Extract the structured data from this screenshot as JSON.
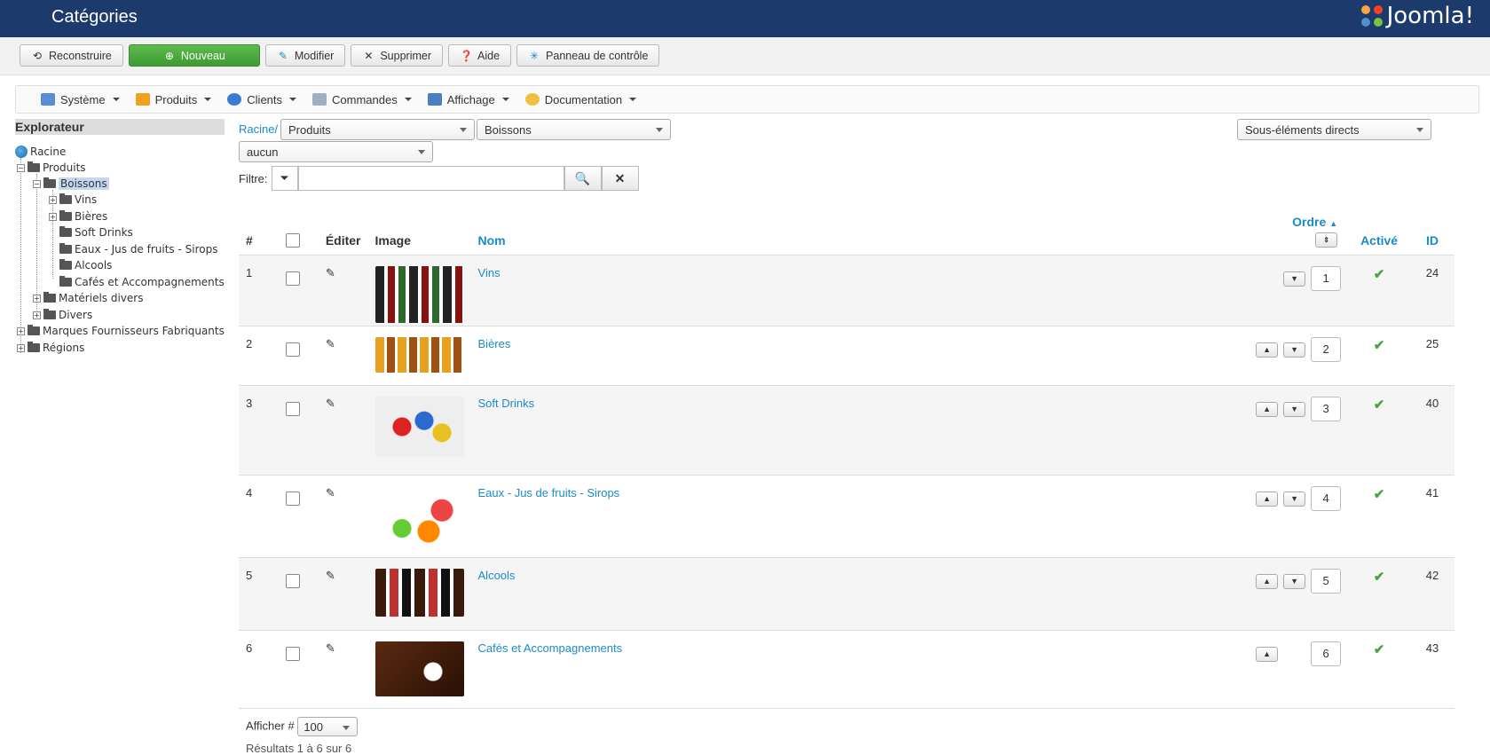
{
  "header": {
    "title": "Catégories",
    "logo_text": "Joomla!"
  },
  "toolbar": [
    {
      "label": "Reconstruire",
      "icon": "rebuild-icon"
    },
    {
      "label": "Nouveau",
      "icon": "plus-circle-icon"
    },
    {
      "label": "Modifier",
      "icon": "edit-icon"
    },
    {
      "label": "Supprimer",
      "icon": "close-icon"
    },
    {
      "label": "Aide",
      "icon": "question-icon"
    },
    {
      "label": "Panneau de contrôle",
      "icon": "dashboard-icon"
    }
  ],
  "menu": [
    "Système",
    "Produits",
    "Clients",
    "Commandes",
    "Affichage",
    "Documentation"
  ],
  "explorer": {
    "title": "Explorateur",
    "nodes": [
      "Racine",
      "Produits",
      "Boissons",
      "Vins",
      "Bières",
      "Soft Drinks",
      "Eaux - Jus de fruits - Sirops",
      "Alcools",
      "Cafés et Accompagnements",
      "Matériels divers",
      "Divers",
      "Marques Fournisseurs Fabriquants",
      "Régions"
    ]
  },
  "breadcrumb": {
    "root": "Racine/",
    "level1": "Produits",
    "level2": "Boissons",
    "level3": "aucun",
    "scope": "Sous-éléments directs"
  },
  "filter": {
    "label": "Filtre:",
    "value": ""
  },
  "columns": {
    "num": "#",
    "edit": "Éditer",
    "image": "Image",
    "name": "Nom",
    "order": "Ordre",
    "active": "Activé",
    "id": "ID"
  },
  "rows": [
    {
      "num": "1",
      "name": "Vins",
      "order": "1",
      "id": "24"
    },
    {
      "num": "2",
      "name": "Bières",
      "order": "2",
      "id": "25"
    },
    {
      "num": "3",
      "name": "Soft Drinks",
      "order": "3",
      "id": "40"
    },
    {
      "num": "4",
      "name": "Eaux - Jus de fruits - Sirops",
      "order": "4",
      "id": "41"
    },
    {
      "num": "5",
      "name": "Alcools",
      "order": "5",
      "id": "42"
    },
    {
      "num": "6",
      "name": "Cafés et Accompagnements",
      "order": "6",
      "id": "43"
    }
  ],
  "pager": {
    "label": "Afficher #",
    "value": "100",
    "results": "Résultats 1 à 6 sur 6"
  }
}
